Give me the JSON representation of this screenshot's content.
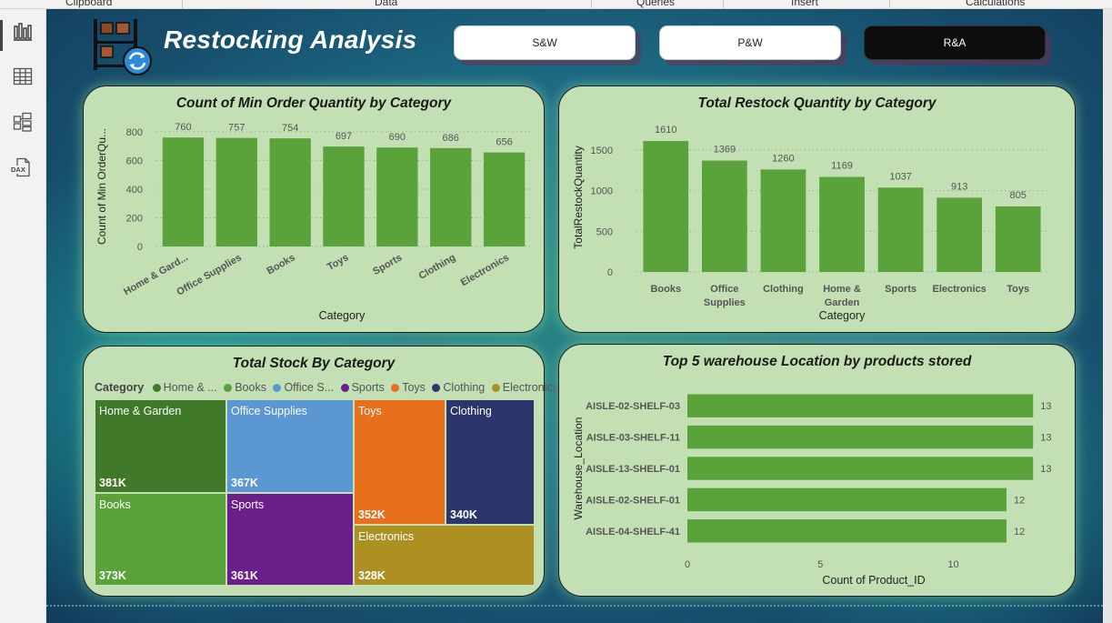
{
  "ribbon": {
    "groups": [
      "Clipboard",
      "Data",
      "Queries",
      "Insert",
      "Calculations"
    ]
  },
  "rail": {
    "items": [
      "report-view-icon",
      "table-view-icon",
      "model-view-icon",
      "dax-query-icon"
    ],
    "dax_label": "DAX"
  },
  "header": {
    "title": "Restocking Analysis"
  },
  "nav": {
    "buttons": [
      {
        "label": "S&W"
      },
      {
        "label": "P&W"
      },
      {
        "label": "R&A"
      }
    ]
  },
  "colors": {
    "bar": "#5aa23a",
    "card": "#c3dfb4"
  },
  "chart1": {
    "title": "Count of Min Order Quantity by Category",
    "chart_data": {
      "type": "bar",
      "title": "Count of Min Order Quantity by Category",
      "categories": [
        "Home & Gard...",
        "Office Supplies",
        "Books",
        "Toys",
        "Sports",
        "Clothing",
        "Electronics"
      ],
      "values": [
        760,
        757,
        754,
        697,
        690,
        686,
        656
      ],
      "xlabel": "Category",
      "ylabel": "Count of Min OrderQu...",
      "yticks": [
        0,
        200,
        400,
        600,
        800
      ],
      "ylim": [
        0,
        850
      ]
    }
  },
  "chart2": {
    "title": "Total Restock Quantity by Category",
    "chart_data": {
      "type": "bar",
      "title": "Total Restock Quantity by Category",
      "categories": [
        "Books",
        "Office Supplies",
        "Clothing",
        "Home & Garden",
        "Sports",
        "Electronics",
        "Toys"
      ],
      "values": [
        1610,
        1369,
        1260,
        1169,
        1037,
        913,
        805
      ],
      "xlabel": "Category",
      "ylabel": "TotalRestockQuantity",
      "yticks": [
        0,
        500,
        1000,
        1500
      ],
      "ylim": [
        0,
        1700
      ]
    }
  },
  "chart3": {
    "title": "Total Stock By Category",
    "legend_title": "Category",
    "legend": [
      {
        "label": "Home & ...",
        "color": "#41792a"
      },
      {
        "label": "Books",
        "color": "#5aa23a"
      },
      {
        "label": "Office S...",
        "color": "#5b97d2"
      },
      {
        "label": "Sports",
        "color": "#6a1f8a"
      },
      {
        "label": "Toys",
        "color": "#e86f1c"
      },
      {
        "label": "Clothing",
        "color": "#2d366c"
      },
      {
        "label": "Electronics",
        "color": "#ad8f22"
      }
    ],
    "chart_data": {
      "type": "treemap",
      "title": "Total Stock By Category",
      "categories": [
        "Home & Garden",
        "Office Supplies",
        "Toys",
        "Clothing",
        "Books",
        "Sports",
        "Electronics"
      ],
      "values": [
        381,
        367,
        352,
        340,
        373,
        361,
        328
      ],
      "value_labels": [
        "381K",
        "367K",
        "352K",
        "340K",
        "373K",
        "361K",
        "328K"
      ]
    }
  },
  "chart4": {
    "title": "Top 5 warehouse Location by products stored",
    "chart_data": {
      "type": "bar",
      "orientation": "horizontal",
      "title": "Top 5 warehouse Location by products stored",
      "categories": [
        "AISLE-02-SHELF-03",
        "AISLE-03-SHELF-11",
        "AISLE-13-SHELF-01",
        "AISLE-02-SHELF-01",
        "AISLE-04-SHELF-41"
      ],
      "values": [
        13,
        13,
        13,
        12,
        12
      ],
      "xlabel": "Count of Product_ID",
      "ylabel": "Warehouse_Location",
      "xticks": [
        0,
        5,
        10
      ],
      "xlim": [
        0,
        13.3
      ]
    }
  }
}
